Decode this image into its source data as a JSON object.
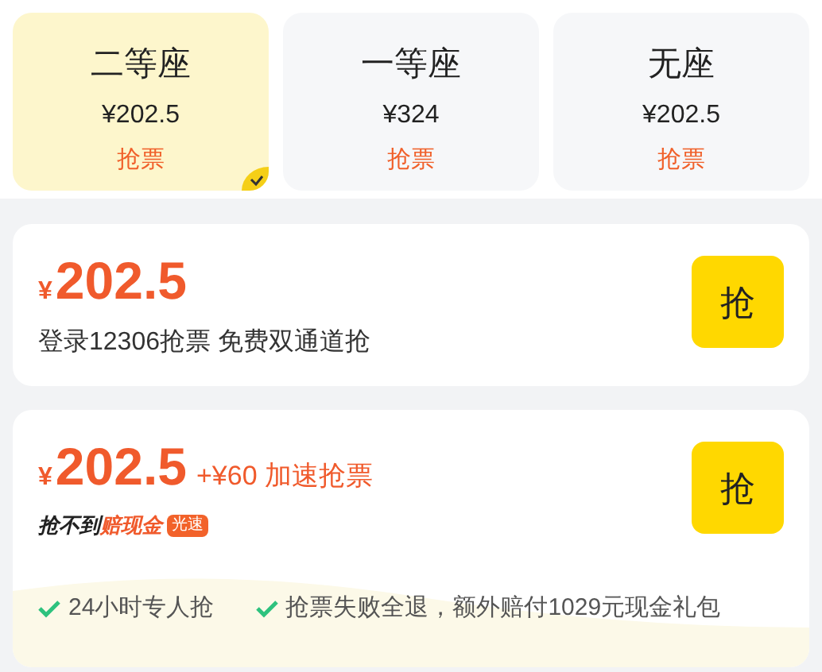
{
  "seat_types": [
    {
      "name": "二等座",
      "price": "¥202.5",
      "action": "抢票",
      "selected": true
    },
    {
      "name": "一等座",
      "price": "¥324",
      "action": "抢票",
      "selected": false
    },
    {
      "name": "无座",
      "price": "¥202.5",
      "action": "抢票",
      "selected": false
    }
  ],
  "offers": [
    {
      "currency": "¥",
      "price": "202.5",
      "description": "登录12306抢票 免费双通道抢",
      "button": "抢"
    },
    {
      "currency": "¥",
      "price": "202.5",
      "extra": "+¥60 加速抢票",
      "slogan_lead": "抢不到",
      "slogan_highlight": "赔现金",
      "badge": "光速",
      "button": "抢",
      "features": [
        "24小时专人抢",
        "抢票失败全退，额外赔付1029元现金礼包"
      ]
    }
  ]
}
